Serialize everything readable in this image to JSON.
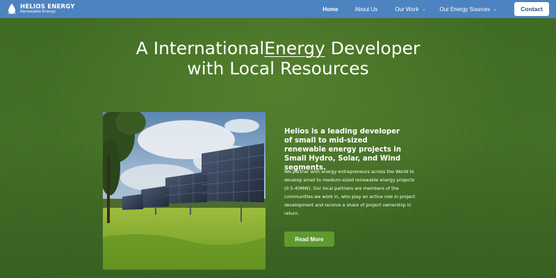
{
  "brand": {
    "name": "HELIOS ENERGY",
    "tagline": "Renewable Energy",
    "logo_icon": "water-drop-icon"
  },
  "nav": {
    "items": [
      {
        "label": "Home",
        "active": true
      },
      {
        "label": "About Us"
      },
      {
        "label": "Our Work",
        "has_dropdown": true
      },
      {
        "label": "Our Energy Sources",
        "has_dropdown": true
      }
    ],
    "contact_label": "Contact"
  },
  "hero": {
    "title_part1": "A International",
    "title_highlight": "Energy",
    "title_part2": " Developer",
    "title_line2": "with Local Resources"
  },
  "content": {
    "intro": "Helios is a leading developer of small to mid-sized renewable energy projects in Small Hydro, Solar, and Wind segments.",
    "body": "We partner with energy entrepreneurs across the World to develop small to medium-sized renewable energy projects (0.5-40MW). Our local partners are members of the communities we work in, who play an active role in project development and receive a share of project ownership in return.",
    "read_more_label": "Read More"
  },
  "colors": {
    "header": "#4e83c2",
    "button": "#5f9a31",
    "background": "#3f6b22"
  }
}
